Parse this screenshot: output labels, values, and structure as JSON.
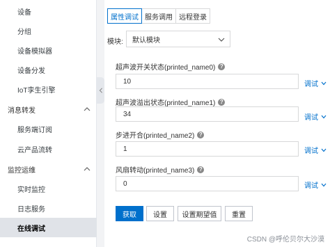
{
  "sidebar": {
    "items": [
      {
        "label": "设备",
        "type": "child"
      },
      {
        "label": "分组",
        "type": "child"
      },
      {
        "label": "设备模拟器",
        "type": "child"
      },
      {
        "label": "设备分发",
        "type": "child"
      },
      {
        "label": "IoT孪生引擎",
        "type": "child"
      },
      {
        "label": "消息转发",
        "type": "group"
      },
      {
        "label": "服务端订阅",
        "type": "child"
      },
      {
        "label": "云产品流转",
        "type": "child"
      },
      {
        "label": "监控运维",
        "type": "group"
      },
      {
        "label": "实时监控",
        "type": "child"
      },
      {
        "label": "日志服务",
        "type": "child"
      },
      {
        "label": "在线调试",
        "type": "child",
        "active": true
      }
    ]
  },
  "tabs": [
    {
      "label": "属性调试",
      "active": true
    },
    {
      "label": "服务调用"
    },
    {
      "label": "远程登录"
    }
  ],
  "module": {
    "label": "模块:",
    "value": "默认模块"
  },
  "properties": [
    {
      "label": "超声波开关状态(printed_name0)",
      "value": "10"
    },
    {
      "label": "超声波溢出状态(printed_name1)",
      "value": "34"
    },
    {
      "label": "步进开合(printed_name2)",
      "value": "1"
    },
    {
      "label": "风扇转动(printed_name3)",
      "value": "0"
    }
  ],
  "debug_label": "调试",
  "help_glyph": "?",
  "buttons": {
    "get": "获取",
    "set": "设置",
    "set_expected": "设置期望值",
    "reset": "重置"
  },
  "watermark": "CSDN @呼伦贝尔大沙漠",
  "colors": {
    "accent": "#0070cc",
    "active_bg": "#e0e3e8",
    "sidebar_bg": "#ffffff"
  },
  "icons": {
    "chevron_down": "chevron-down-icon",
    "chevron_up": "chevron-up-icon",
    "chevron_left": "chevron-left-icon",
    "help": "help-circle-icon"
  }
}
